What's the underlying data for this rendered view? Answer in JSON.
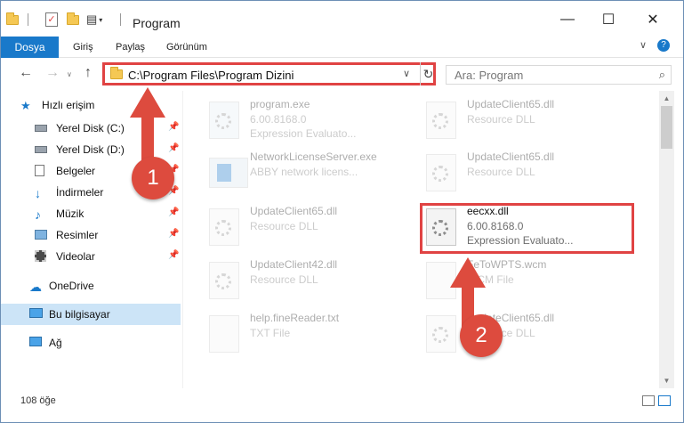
{
  "window": {
    "title": "Program",
    "controls": {
      "minimize": "—",
      "maximize": "☐",
      "close": "✕"
    }
  },
  "ribbon": {
    "file_tab": "Dosya",
    "tabs": [
      "Giriş",
      "Paylaş",
      "Görünüm"
    ]
  },
  "nav": {
    "back": "←",
    "forward": "→",
    "up": "↑",
    "address": "C:\\Program Files\\Program Dizini",
    "search_placeholder": "Ara: Program"
  },
  "sidebar": {
    "quick_access": "Hızlı erişim",
    "items": [
      {
        "label": "Yerel Disk (C:)",
        "pinned": true
      },
      {
        "label": "Yerel Disk (D:)",
        "pinned": true
      },
      {
        "label": "Belgeler",
        "pinned": true
      },
      {
        "label": "İndirmeler",
        "pinned": true
      },
      {
        "label": "Müzik",
        "pinned": true
      },
      {
        "label": "Resimler",
        "pinned": true
      },
      {
        "label": "Videolar",
        "pinned": true
      }
    ],
    "onedrive": "OneDrive",
    "this_pc": "Bu bilgisayar",
    "network": "Ağ"
  },
  "files": [
    {
      "name": "program.exe",
      "line2": "6.00.8168.0",
      "line3": "Expression Evaluato..."
    },
    {
      "name": "NetworkLicenseServer.exe",
      "line2": "ABBY network licens...",
      "line3": ""
    },
    {
      "name": "UpdateClient65.dll",
      "line2": "Resource DLL",
      "line3": ""
    },
    {
      "name": "UpdateClient42.dll",
      "line2": "Resource DLL",
      "line3": ""
    },
    {
      "name": "help.fineReader.txt",
      "line2": "TXT File",
      "line3": ""
    },
    {
      "name": "UpdateClient65.dll",
      "line2": "Resource DLL",
      "line3": ""
    },
    {
      "name": "UpdateClient65.dll",
      "line2": "Resource DLL",
      "line3": ""
    },
    {
      "name": "eecxx.dll",
      "line2": "6.00.8168.0",
      "line3": "Expression Evaluato..."
    },
    {
      "name": "FeToWPTS.wcm",
      "line2": "WCM File",
      "line3": ""
    },
    {
      "name": "UpdateClient65.dll",
      "line2": "Resource DLL",
      "line3": ""
    }
  ],
  "status": {
    "count": "108 öğe"
  },
  "badges": [
    "1",
    "2"
  ],
  "colors": {
    "accent": "#1979ca",
    "highlight": "#e04343",
    "badge": "#dd4b3e",
    "selected": "#cce4f7"
  }
}
